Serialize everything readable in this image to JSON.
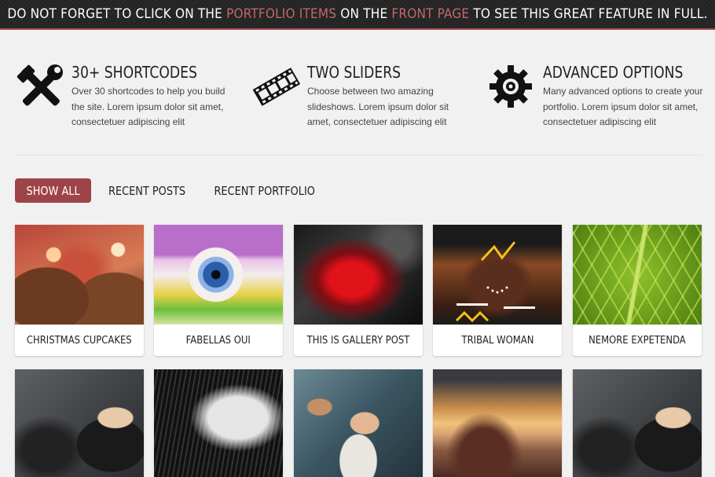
{
  "banner": {
    "part1": "DO NOT FORGET TO CLICK ON THE",
    "link1": "PORTFOLIO ITEMS",
    "part2": "ON THE",
    "link2": "FRONT PAGE",
    "part3": "TO SEE THIS GREAT FEATURE IN FULL."
  },
  "features": [
    {
      "icon": "tools-icon",
      "title": "30+ SHORTCODES",
      "description": "Over 30 shortcodes to help you build the site. Lorem ipsum dolor sit amet, consectetuer adipiscing elit"
    },
    {
      "icon": "film-strip-icon",
      "title": "TWO SLIDERS",
      "description": "Choose between two amazing slideshows. Lorem ipsum dolor sit amet, consectetuer adipiscing elit"
    },
    {
      "icon": "gear-icon",
      "title": "ADVANCED OPTIONS",
      "description": "Many advanced options to create your portfolio. Lorem ipsum dolor sit amet, consectetuer adipiscing elit"
    }
  ],
  "filters": {
    "show_all": "SHOW ALL",
    "recent_posts": "RECENT POSTS",
    "recent_portfolio": "RECENT PORTFOLIO"
  },
  "portfolio": {
    "row1": [
      {
        "title": "CHRISTMAS CUPCAKES",
        "image": "cupcake-photo"
      },
      {
        "title": "FABELLAS OUI",
        "image": "eye-makeup-photo"
      },
      {
        "title": "THIS IS GALLERY POST",
        "image": "abstract-red-photo"
      },
      {
        "title": "TRIBAL WOMAN",
        "image": "tribal-woman-photo"
      },
      {
        "title": "NEMORE EXPETENDA",
        "image": "green-leaf-photo"
      }
    ],
    "row2": [
      {
        "image": "boxer-woman-photo"
      },
      {
        "image": "bw-portrait-photo"
      },
      {
        "image": "climber-photo"
      },
      {
        "image": "coast-sunset-photo"
      },
      {
        "image": "boxer-woman-photo"
      }
    ]
  },
  "colors": {
    "accent": "#9e4448",
    "banner_link": "#c0686c",
    "banner_bg": "#262626"
  }
}
